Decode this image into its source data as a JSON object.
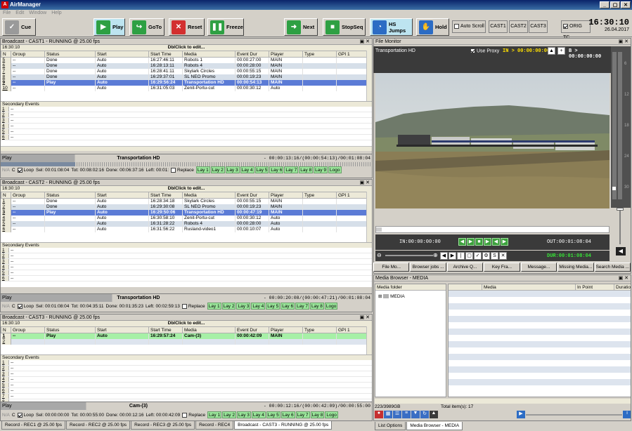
{
  "app": {
    "title": "AirManager",
    "icon": "A"
  },
  "window_controls": [
    "_",
    "▢",
    "✕"
  ],
  "menu": [
    "File",
    "Edit",
    "Window",
    "Help"
  ],
  "toolbar": {
    "cue": "Cue",
    "play": "Play",
    "goto": "GoTo",
    "reset": "Reset",
    "freeze": "Freeze",
    "next": "Next",
    "stopseq": "StopSeq",
    "hsjumps": "HS Jumps",
    "hold": "Hold",
    "autoscroll": "Auto Scroll",
    "cast1": "CAST1",
    "cast2": "CAST2",
    "cast3": "CAST3",
    "origtc": "ORIG TC"
  },
  "clock": {
    "time": "16:30:10",
    "date": "26.04.2017"
  },
  "columns": [
    "N",
    "Group",
    "Status",
    "Start",
    "Start Time",
    "Media",
    "Event Dur",
    "Player",
    "Type",
    "GPI 1"
  ],
  "dblclick": "DblClick to edit...",
  "secondary_label": "Secondary Events",
  "cast1": {
    "header": "Broadcast - CAST1 - RUNNING @ 25.00 fps",
    "time": "16:30:10",
    "rows": [
      {
        "n": "5",
        "group": "--",
        "status": "Done",
        "start": "Auto",
        "st": "16:27:46:11",
        "media": "Robots 1",
        "dur": "00:00:27:00",
        "player": "MAIN",
        "cls": "done"
      },
      {
        "n": "6",
        "group": "--",
        "status": "Done",
        "start": "Auto",
        "st": "16:28:13:11",
        "media": "Robots 4",
        "dur": "00:00:28:00",
        "player": "MAIN",
        "cls": "alt"
      },
      {
        "n": "7",
        "group": "--",
        "status": "Done",
        "start": "Auto",
        "st": "16:28:41:11",
        "media": "Skylark Circles",
        "dur": "00:00:55:15",
        "player": "MAIN",
        "cls": "done"
      },
      {
        "n": "8",
        "group": "--",
        "status": "Done",
        "start": "Auto",
        "st": "16:29:37:01",
        "media": "SL NEO Promo",
        "dur": "00:00:19:23",
        "player": "MAIN",
        "cls": "alt"
      },
      {
        "n": "9",
        "group": "--",
        "status": "Play",
        "start": "Auto",
        "st": "16:29:56:24",
        "media": "Transportation HD",
        "dur": "00:00:54:13",
        "player": "MAIN",
        "cls": "play"
      },
      {
        "n": "10",
        "group": "--",
        "status": "",
        "start": "Auto",
        "st": "16:31:05:03",
        "media": "Zenit-Portu-cut",
        "dur": "00:00:30:12",
        "player": "Auto",
        "cls": "done"
      }
    ],
    "secondary": [
      "1",
      "2",
      "3",
      "4",
      "5",
      "6"
    ],
    "status_state": "Play",
    "status_name": "Transportation HD",
    "status_tc": "- 00:00:13:16/(00:00:54:13)/00:01:08:04",
    "progress": 0.2,
    "na": "N/A",
    "c": "C",
    "loop": "Loop",
    "sel": "Sel: 00:01:08:04",
    "tot": "Tot: 00:08:02:16",
    "done": "Done: 00:06:37:16",
    "left": "Left: 00:01:",
    "replace": "Replace",
    "lays": [
      "Lay 1",
      "Lay 2",
      "Lay 3",
      "Lay 4",
      "Lay 5",
      "Lay 6",
      "Lay 7",
      "Lay 8",
      "Lay 9",
      "Logo"
    ]
  },
  "cast2": {
    "header": "Broadcast - CAST2 - RUNNING @ 25.00 fps",
    "time": "16:30:10",
    "rows": [
      {
        "n": "1",
        "group": "--",
        "status": "Done",
        "start": "Auto",
        "st": "16:28:34:18",
        "media": "Skylark Circles",
        "dur": "00:00:55:15",
        "player": "MAIN",
        "cls": "done"
      },
      {
        "n": "2",
        "group": "--",
        "status": "Done",
        "start": "Auto",
        "st": "16:29:30:08",
        "media": "SL NEO Promo",
        "dur": "00:00:19:23",
        "player": "MAIN",
        "cls": "alt"
      },
      {
        "n": "3",
        "group": "--",
        "status": "Play",
        "start": "Auto",
        "st": "16:29:50:06",
        "media": "Transportation HD",
        "dur": "00:00:47:19",
        "player": "MAIN",
        "cls": "play"
      },
      {
        "n": "4",
        "group": "--",
        "status": "",
        "start": "Auto",
        "st": "16:30:58:10",
        "media": "Zenit-Portu-cut",
        "dur": "00:00:30:12",
        "player": "Auto",
        "cls": "done"
      },
      {
        "n": "5",
        "group": "--",
        "status": "",
        "start": "Auto",
        "st": "16:31:28:22",
        "media": "Robots 4",
        "dur": "00:00:28:00",
        "player": "Auto",
        "cls": "alt"
      },
      {
        "n": "6",
        "group": "--",
        "status": "",
        "start": "Auto",
        "st": "16:31:56:22",
        "media": "Rusland-video1",
        "dur": "00:00:10:07",
        "player": "Auto",
        "cls": "done"
      }
    ],
    "secondary": [
      "1",
      "2",
      "3",
      "4",
      "5",
      "6"
    ],
    "status_state": "Play",
    "status_name": "Transportation HD",
    "status_tc": "- 00:00:20:08/(00:00:47:21)/00:01:08:04",
    "progress": 0.3,
    "na": "N/A",
    "c": "C",
    "loop": "Loop",
    "sel": "Sel: 00:01:08:04",
    "tot": "Tot: 00:04:35:11",
    "done": "Done: 00:01:35:23",
    "left": "Left: 00:02:59:13",
    "replace": "Replace",
    "lays": [
      "Lay 1",
      "Lay 2",
      "Lay 3",
      "Lay 4",
      "Lay 5",
      "Lay 6",
      "Lay 7",
      "Lay 8",
      "Logo"
    ]
  },
  "cast3": {
    "header": "Broadcast - CAST3 - RUNNING @ 25.00 fps",
    "time": "16:30:10",
    "rows": [
      {
        "n": "1",
        "group": "--",
        "status": "Play",
        "start": "Auto",
        "st": "16:29:57:24",
        "media": "Cam-(3)",
        "dur": "00:00:42:09",
        "player": "MAIN",
        "cls": "playg"
      },
      {
        "n": "2",
        "group": "",
        "status": "",
        "start": "",
        "st": "",
        "media": "",
        "dur": "",
        "player": "",
        "cls": "blank"
      }
    ],
    "secondary": [
      "1",
      "2",
      "3",
      "4",
      "5",
      "6",
      "7",
      "8"
    ],
    "status_state": "Play",
    "status_name": "Cam-(3)",
    "status_tc": "- 00:00:12:16/(00:00:42:09)/00:00:55:00",
    "progress": 0.22,
    "na": "N/A",
    "c": "C",
    "loop": "Loop",
    "sel": "Sel: 00:00:00:00",
    "tot": "Tot: 00:00:55:00",
    "done": "Done: 00:00:12:16",
    "left": "Left: 00:00:42:09",
    "replace": "Replace",
    "lays": [
      "Lay 1",
      "Lay 2",
      "Lay 3",
      "Lay 4",
      "Lay 5",
      "Lay 6",
      "Lay 7",
      "Lay 8",
      "Logo"
    ]
  },
  "bottom_tabs": [
    "Record - REC1 @ 25.00 fps",
    "Record - REC2 @ 25.00 fps",
    "Record - REC3 @ 25.00 fps",
    "Record - REC4",
    "Broadcast - CAST3 - RUNNING @ 25.00 fps"
  ],
  "monitor": {
    "header": "File Monitor",
    "media": "Transportation HD",
    "use_proxy": "Use Proxy",
    "in_label": "IN > 00:00:00:00",
    "b_label": "B > 00:00:00:00",
    "in_tc": "IN:00:00:00:00",
    "out_tc": "OUT:00:01:08:04",
    "dur_tc": "DUR:00:01:08:04",
    "scale": [
      "6",
      "12",
      "18",
      "24",
      "30"
    ],
    "controls": [
      "◀",
      "▶",
      "■",
      "▶",
      "◀",
      "▶"
    ]
  },
  "tool_buttons": [
    "File Mo...",
    "Browser jobs ...",
    "Archive Q...",
    "Key Fra...",
    "Message...",
    "Missing Media...",
    "Search Media ..."
  ],
  "browser": {
    "header": "Media Browser - MEDIA",
    "folder_col": "Media folder",
    "cols": [
      "Media",
      "In Point",
      "Duratio"
    ],
    "root": "MEDIA",
    "storage": "223/3989GB",
    "total": "Total item(s): 17"
  },
  "right_tabs": [
    "List Options",
    "Media Browser - MEDIA"
  ]
}
